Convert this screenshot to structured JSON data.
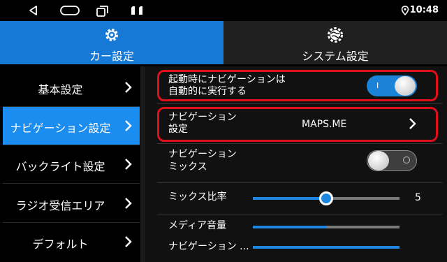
{
  "status_bar": {
    "time": "10:48",
    "icons": [
      "back-icon",
      "home-icon",
      "recent-apps-icon",
      "sd-card-icon",
      "location-icon"
    ]
  },
  "tabs": [
    {
      "label": "カー設定",
      "icon": "gear-icon",
      "active": true
    },
    {
      "label": "システム設定",
      "icon": "globe-gear-icon",
      "active": false
    }
  ],
  "sidebar": {
    "items": [
      {
        "label": "基本設定",
        "active": false
      },
      {
        "label": "ナビゲーション設定",
        "active": true
      },
      {
        "label": "バックライト設定",
        "active": false
      },
      {
        "label": "ラジオ受信エリア",
        "active": false
      },
      {
        "label": "デフォルト",
        "active": false
      }
    ]
  },
  "settings": {
    "auto_launch": {
      "label_line1": "起動時にナビゲーションは",
      "label_line2": "自動的に実行する",
      "on": true,
      "on_mark": "I"
    },
    "nav_app": {
      "label_line1": "ナビゲーション",
      "label_line2": "設定",
      "value": "MAPS.ME"
    },
    "nav_mix": {
      "label_line1": "ナビゲーション",
      "label_line2": "ミックス",
      "on": false
    },
    "mix_ratio": {
      "label": "ミックス比率",
      "value": "5",
      "level": 0.5
    },
    "media_volume": {
      "label": "メディア音量",
      "level": 0.5
    },
    "nav_volume": {
      "label": "ナビゲーション ...",
      "level": 1.0
    }
  },
  "colors": {
    "accent": "#1b8cf0",
    "tab_active": "#1779d6",
    "highlight_outline": "#e0101a"
  }
}
